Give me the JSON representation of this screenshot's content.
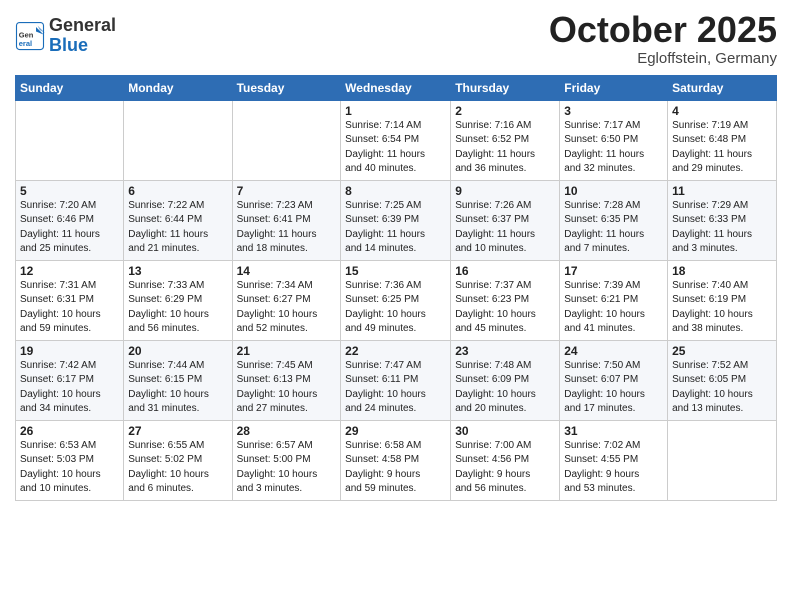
{
  "header": {
    "logo_general": "General",
    "logo_blue": "Blue",
    "month": "October 2025",
    "location": "Egloffstein, Germany"
  },
  "weekdays": [
    "Sunday",
    "Monday",
    "Tuesday",
    "Wednesday",
    "Thursday",
    "Friday",
    "Saturday"
  ],
  "weeks": [
    [
      {
        "num": "",
        "info": ""
      },
      {
        "num": "",
        "info": ""
      },
      {
        "num": "",
        "info": ""
      },
      {
        "num": "1",
        "info": "Sunrise: 7:14 AM\nSunset: 6:54 PM\nDaylight: 11 hours\nand 40 minutes."
      },
      {
        "num": "2",
        "info": "Sunrise: 7:16 AM\nSunset: 6:52 PM\nDaylight: 11 hours\nand 36 minutes."
      },
      {
        "num": "3",
        "info": "Sunrise: 7:17 AM\nSunset: 6:50 PM\nDaylight: 11 hours\nand 32 minutes."
      },
      {
        "num": "4",
        "info": "Sunrise: 7:19 AM\nSunset: 6:48 PM\nDaylight: 11 hours\nand 29 minutes."
      }
    ],
    [
      {
        "num": "5",
        "info": "Sunrise: 7:20 AM\nSunset: 6:46 PM\nDaylight: 11 hours\nand 25 minutes."
      },
      {
        "num": "6",
        "info": "Sunrise: 7:22 AM\nSunset: 6:44 PM\nDaylight: 11 hours\nand 21 minutes."
      },
      {
        "num": "7",
        "info": "Sunrise: 7:23 AM\nSunset: 6:41 PM\nDaylight: 11 hours\nand 18 minutes."
      },
      {
        "num": "8",
        "info": "Sunrise: 7:25 AM\nSunset: 6:39 PM\nDaylight: 11 hours\nand 14 minutes."
      },
      {
        "num": "9",
        "info": "Sunrise: 7:26 AM\nSunset: 6:37 PM\nDaylight: 11 hours\nand 10 minutes."
      },
      {
        "num": "10",
        "info": "Sunrise: 7:28 AM\nSunset: 6:35 PM\nDaylight: 11 hours\nand 7 minutes."
      },
      {
        "num": "11",
        "info": "Sunrise: 7:29 AM\nSunset: 6:33 PM\nDaylight: 11 hours\nand 3 minutes."
      }
    ],
    [
      {
        "num": "12",
        "info": "Sunrise: 7:31 AM\nSunset: 6:31 PM\nDaylight: 10 hours\nand 59 minutes."
      },
      {
        "num": "13",
        "info": "Sunrise: 7:33 AM\nSunset: 6:29 PM\nDaylight: 10 hours\nand 56 minutes."
      },
      {
        "num": "14",
        "info": "Sunrise: 7:34 AM\nSunset: 6:27 PM\nDaylight: 10 hours\nand 52 minutes."
      },
      {
        "num": "15",
        "info": "Sunrise: 7:36 AM\nSunset: 6:25 PM\nDaylight: 10 hours\nand 49 minutes."
      },
      {
        "num": "16",
        "info": "Sunrise: 7:37 AM\nSunset: 6:23 PM\nDaylight: 10 hours\nand 45 minutes."
      },
      {
        "num": "17",
        "info": "Sunrise: 7:39 AM\nSunset: 6:21 PM\nDaylight: 10 hours\nand 41 minutes."
      },
      {
        "num": "18",
        "info": "Sunrise: 7:40 AM\nSunset: 6:19 PM\nDaylight: 10 hours\nand 38 minutes."
      }
    ],
    [
      {
        "num": "19",
        "info": "Sunrise: 7:42 AM\nSunset: 6:17 PM\nDaylight: 10 hours\nand 34 minutes."
      },
      {
        "num": "20",
        "info": "Sunrise: 7:44 AM\nSunset: 6:15 PM\nDaylight: 10 hours\nand 31 minutes."
      },
      {
        "num": "21",
        "info": "Sunrise: 7:45 AM\nSunset: 6:13 PM\nDaylight: 10 hours\nand 27 minutes."
      },
      {
        "num": "22",
        "info": "Sunrise: 7:47 AM\nSunset: 6:11 PM\nDaylight: 10 hours\nand 24 minutes."
      },
      {
        "num": "23",
        "info": "Sunrise: 7:48 AM\nSunset: 6:09 PM\nDaylight: 10 hours\nand 20 minutes."
      },
      {
        "num": "24",
        "info": "Sunrise: 7:50 AM\nSunset: 6:07 PM\nDaylight: 10 hours\nand 17 minutes."
      },
      {
        "num": "25",
        "info": "Sunrise: 7:52 AM\nSunset: 6:05 PM\nDaylight: 10 hours\nand 13 minutes."
      }
    ],
    [
      {
        "num": "26",
        "info": "Sunrise: 6:53 AM\nSunset: 5:03 PM\nDaylight: 10 hours\nand 10 minutes."
      },
      {
        "num": "27",
        "info": "Sunrise: 6:55 AM\nSunset: 5:02 PM\nDaylight: 10 hours\nand 6 minutes."
      },
      {
        "num": "28",
        "info": "Sunrise: 6:57 AM\nSunset: 5:00 PM\nDaylight: 10 hours\nand 3 minutes."
      },
      {
        "num": "29",
        "info": "Sunrise: 6:58 AM\nSunset: 4:58 PM\nDaylight: 9 hours\nand 59 minutes."
      },
      {
        "num": "30",
        "info": "Sunrise: 7:00 AM\nSunset: 4:56 PM\nDaylight: 9 hours\nand 56 minutes."
      },
      {
        "num": "31",
        "info": "Sunrise: 7:02 AM\nSunset: 4:55 PM\nDaylight: 9 hours\nand 53 minutes."
      },
      {
        "num": "",
        "info": ""
      }
    ]
  ]
}
